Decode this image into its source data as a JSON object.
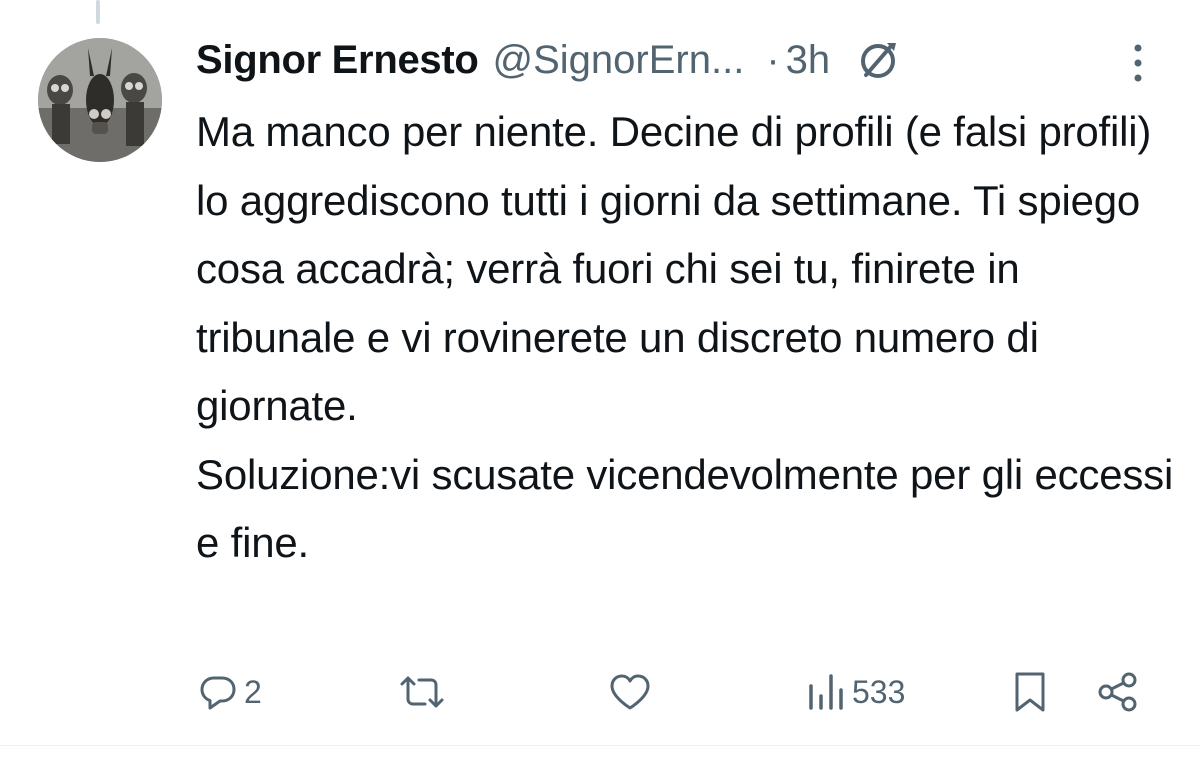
{
  "author": {
    "display_name": "Signor Ernesto",
    "handle": "@SignorErn...",
    "separator": "·",
    "time": "3h"
  },
  "tweet": {
    "paragraphs": [
      "Ma manco per niente. Decine di profili (e falsi profili) lo aggrediscono tutti i giorni da settimane. Ti spiego cosa accadrà; verrà fuori chi sei tu, finirete in tribunale e vi rovinerete un discreto numero di giornate.",
      "Soluzione:vi scusate vicendevolmente per gli eccessi e fine."
    ]
  },
  "actions": {
    "reply_count": "2",
    "retweet_count": "",
    "like_count": "",
    "views_count": "533"
  },
  "icons": {
    "verified": "verified-badge-icon",
    "more": "more-options-icon",
    "reply": "reply-icon",
    "retweet": "retweet-icon",
    "like": "like-icon",
    "views": "views-icon",
    "bookmark": "bookmark-icon",
    "share": "share-icon"
  },
  "colors": {
    "text": "#0f1419",
    "secondary": "#536471",
    "icon": "#536471"
  }
}
